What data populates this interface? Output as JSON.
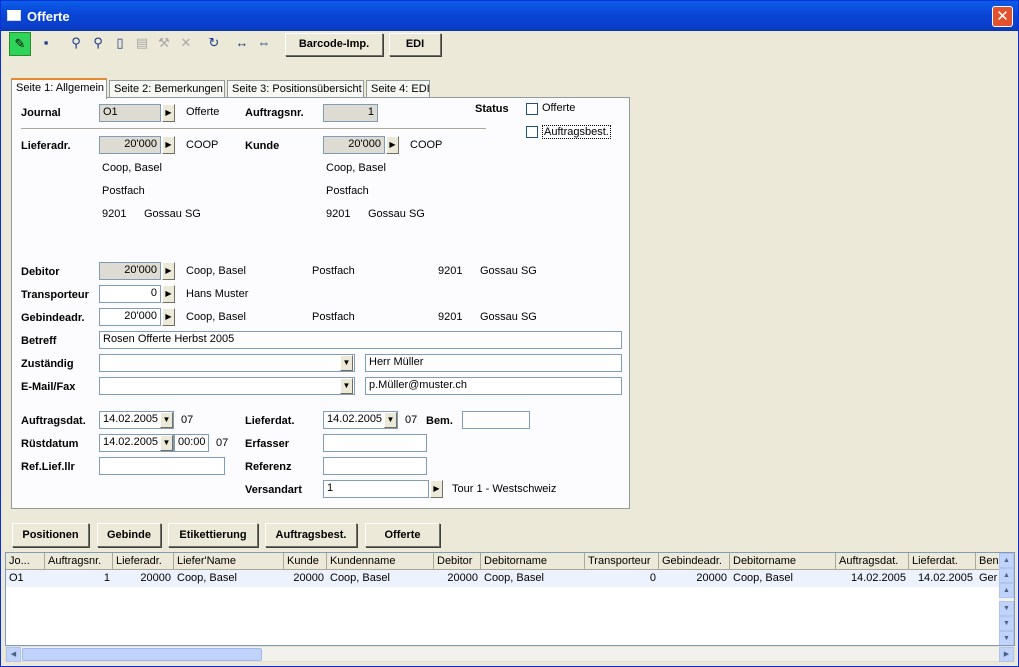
{
  "window": {
    "title": "Offerte",
    "close_label": "✕"
  },
  "toolbar": {
    "barcode_label": "Barcode-Imp.",
    "edi_label": "EDI"
  },
  "tabs": [
    "Seite 1: Allgemein",
    "Seite 2: Bemerkungen",
    "Seite 3: Positionsübersicht",
    "Seite 4: EDI"
  ],
  "form": {
    "journal_label": "Journal",
    "journal_value": "O1",
    "journal_text": "Offerte",
    "auftragsnr_label": "Auftragsnr.",
    "auftragsnr_value": "1",
    "status_label": "Status",
    "status_offerte": "Offerte",
    "status_auftragsbest": "Auftragsbest.",
    "lieferadr_label": "Lieferadr.",
    "lieferadr_value": "20'000",
    "lieferadr_code": "COOP",
    "lieferadr_line1": "Coop, Basel",
    "lieferadr_line2": "Postfach",
    "lieferadr_plz": "9201",
    "lieferadr_ort": "Gossau SG",
    "kunde_label": "Kunde",
    "kunde_value": "20'000",
    "kunde_code": "COOP",
    "kunde_line1": "Coop, Basel",
    "kunde_line2": "Postfach",
    "kunde_plz": "9201",
    "kunde_ort": "Gossau SG",
    "debitor_label": "Debitor",
    "debitor_value": "20'000",
    "debitor_name": "Coop, Basel",
    "debitor_postfach": "Postfach",
    "debitor_plz": "9201",
    "debitor_ort": "Gossau SG",
    "transporteur_label": "Transporteur",
    "transporteur_value": "0",
    "transporteur_name": "Hans Muster",
    "gebindeadr_label": "Gebindeadr.",
    "gebindeadr_value": "20'000",
    "gebindeadr_name": "Coop, Basel",
    "gebindeadr_postfach": "Postfach",
    "gebindeadr_plz": "9201",
    "gebindeadr_ort": "Gossau SG",
    "betreff_label": "Betreff",
    "betreff_value": "Rosen Offerte Herbst 2005",
    "zustaendig_label": "Zuständig",
    "zustaendig_value": "",
    "zustaendig_name": "Herr Müller",
    "email_label": "E-Mail/Fax",
    "email_value": "",
    "email_addr": "p.Müller@muster.ch",
    "auftragsdat_label": "Auftragsdat.",
    "auftragsdat_value": "14.02.2005",
    "auftragsdat_week": "07",
    "lieferdat_label": "Lieferdat.",
    "lieferdat_value": "14.02.2005",
    "lieferdat_week": "07",
    "bem_label": "Bem.",
    "bem_value": "",
    "ruestdatum_label": "Rüstdatum",
    "ruestdatum_value": "14.02.2005",
    "ruestdatum_time": "00:00",
    "ruestdatum_week": "07",
    "erfasser_label": "Erfasser",
    "erfasser_value": "",
    "reflieflr_label": "Ref.Lief.llr",
    "reflieflr_value": "",
    "referenz_label": "Referenz",
    "referenz_value": "",
    "versandart_label": "Versandart",
    "versandart_value": "1",
    "versandart_text": "Tour 1 - Westschweiz"
  },
  "bottom_buttons": [
    "Positionen",
    "Gebinde",
    "Etikettierung",
    "Auftragsbest.",
    "Offerte"
  ],
  "grid": {
    "columns": [
      "Jo...",
      "Auftragsnr.",
      "Lieferadr.",
      "Liefer'Name",
      "Kunde",
      "Kundenname",
      "Debitor",
      "Debitorname",
      "Transporteur",
      "Gebindeadr.",
      "Debitorname",
      "Auftragsdat.",
      "Lieferdat.",
      "Ben"
    ],
    "rows": [
      [
        "O1",
        "1",
        "20000",
        "Coop, Basel",
        "20000",
        "Coop, Basel",
        "20000",
        "Coop, Basel",
        "0",
        "20000",
        "Coop, Basel",
        "14.02.2005",
        "14.02.2005",
        "Ger"
      ]
    ]
  }
}
